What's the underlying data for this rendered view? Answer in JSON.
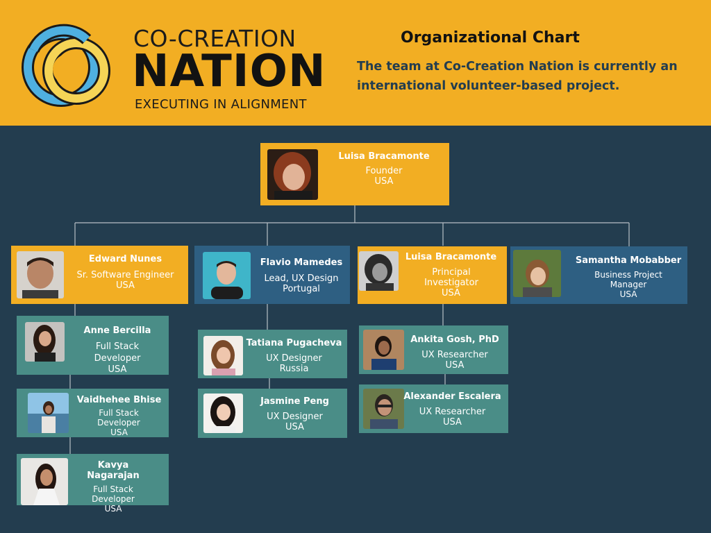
{
  "header": {
    "logo_line1": "CO-CREATION",
    "logo_line2": "NATION",
    "logo_line3": "EXECUTING IN ALIGNMENT",
    "title": "Organizational Chart",
    "subtitle": "The team at Co-Creation Nation  is currently an international volunteer-based project.",
    "colors": {
      "background": "#f2ae23",
      "ring_blue": "#4fb0e0",
      "ring_yellow": "#f5d456",
      "outline": "#1a1a1a"
    }
  },
  "colors": {
    "page_bg": "#233d4f",
    "yellow_card": "#f2ae23",
    "blue_card": "#2e5f82",
    "teal_card": "#4a8d87",
    "connector": "#b8c0c6"
  },
  "people": {
    "founder": {
      "name": "Luisa Bracamonte",
      "role": "Founder",
      "country": "USA"
    },
    "edward": {
      "name": "Edward Nunes",
      "role": "Sr. Software Engineer",
      "country": "USA"
    },
    "flavio": {
      "name": "Flavio Mamedes",
      "role": "Lead, UX Design",
      "country": "Portugal"
    },
    "luisa_pi": {
      "name": "Luisa Bracamonte",
      "role": "Principal Investigator",
      "country": "USA"
    },
    "samantha": {
      "name": "Samantha Mobabber",
      "role": "Business Project Manager",
      "country": "USA"
    },
    "anne": {
      "name": "Anne Bercilla",
      "role": "Full Stack Developer",
      "country": "USA"
    },
    "vaidhehee": {
      "name": "Vaidhehee Bhise",
      "role": "Full Stack Developer",
      "country": "USA"
    },
    "kavya": {
      "name": "Kavya Nagarajan",
      "role": "Full Stack Developer",
      "country": "USA"
    },
    "tatiana": {
      "name": "Tatiana Pugacheva",
      "role": "UX Designer",
      "country": "Russia"
    },
    "jasmine": {
      "name": "Jasmine Peng",
      "role": "UX Designer",
      "country": "USA"
    },
    "ankita": {
      "name": "Ankita Gosh, PhD",
      "role": "UX Researcher",
      "country": "USA"
    },
    "alexander": {
      "name": "Alexander Escalera",
      "role": "UX Researcher",
      "country": "USA"
    }
  }
}
